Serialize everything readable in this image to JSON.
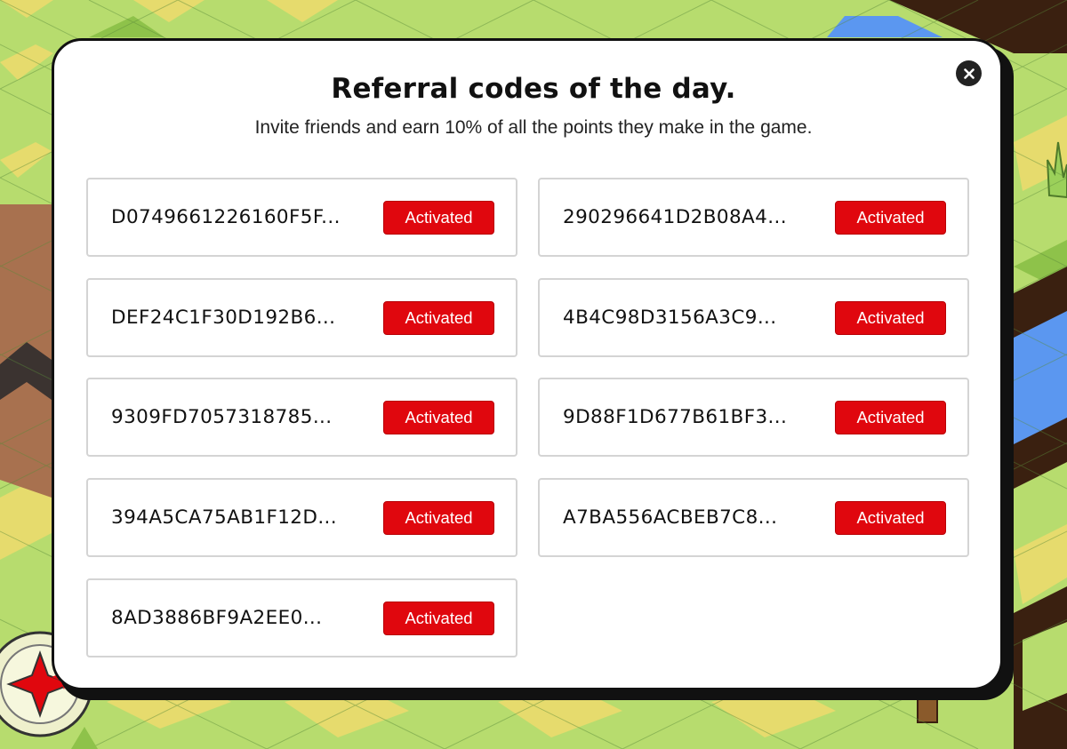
{
  "modal": {
    "title": "Referral codes of the day.",
    "subtitle": "Invite friends and earn 10% of all the points they make in the game.",
    "close_icon": "close-icon"
  },
  "codes": [
    {
      "code": "D0749661226160F5F...",
      "status": "Activated"
    },
    {
      "code": "290296641D2B08A4...",
      "status": "Activated"
    },
    {
      "code": "DEF24C1F30D192B6...",
      "status": "Activated"
    },
    {
      "code": "4B4C98D3156A3C9...",
      "status": "Activated"
    },
    {
      "code": "9309FD7057318785...",
      "status": "Activated"
    },
    {
      "code": "9D88F1D677B61BF3...",
      "status": "Activated"
    },
    {
      "code": "394A5CA75AB1F12D...",
      "status": "Activated"
    },
    {
      "code": "A7BA556ACBEB7C8...",
      "status": "Activated"
    },
    {
      "code": "8AD3886BF9A2EE0...",
      "status": "Activated"
    }
  ],
  "colors": {
    "status_button": "#e0070e",
    "card_border": "#d4d4d4",
    "modal_background": "#ffffff",
    "modal_shadow": "#111111",
    "grass": "#b7dc6e",
    "sand": "#e8dc6a",
    "water": "#5b97f0",
    "dirt": "#a8714f",
    "soil_dark": "#3a2010"
  }
}
